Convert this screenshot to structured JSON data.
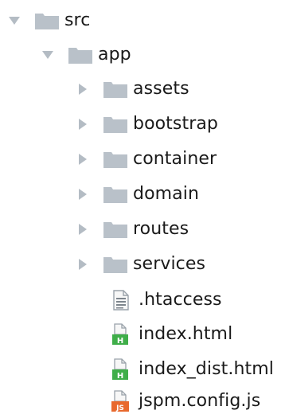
{
  "tree": {
    "root": {
      "label": "src",
      "state": "expanded",
      "icon": "folder-icon"
    },
    "app": {
      "label": "app",
      "state": "expanded",
      "icon": "folder-icon"
    },
    "folders": [
      {
        "label": "assets",
        "state": "collapsed",
        "icon": "folder-icon"
      },
      {
        "label": "bootstrap",
        "state": "collapsed",
        "icon": "folder-icon"
      },
      {
        "label": "container",
        "state": "collapsed",
        "icon": "folder-icon"
      },
      {
        "label": "domain",
        "state": "collapsed",
        "icon": "folder-icon"
      },
      {
        "label": "routes",
        "state": "collapsed",
        "icon": "folder-icon"
      },
      {
        "label": "services",
        "state": "collapsed",
        "icon": "folder-icon"
      }
    ],
    "files": [
      {
        "label": ".htaccess",
        "icon": "text-file-icon"
      },
      {
        "label": "index.html",
        "icon": "html-file-icon",
        "badge": "H",
        "badge_color": "#3fae49"
      },
      {
        "label": "index_dist.html",
        "icon": "html-file-icon",
        "badge": "H",
        "badge_color": "#3fae49"
      },
      {
        "label": "jspm.config.js",
        "icon": "js-file-icon",
        "badge": "JS",
        "badge_color": "#e8692e"
      }
    ]
  },
  "colors": {
    "folder": "#b9c1c9",
    "arrow": "#b4bcc4",
    "text": "#1a1a1a"
  }
}
